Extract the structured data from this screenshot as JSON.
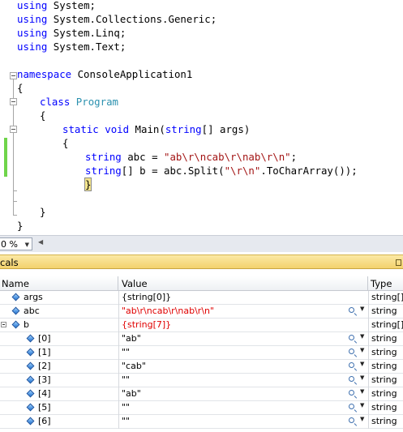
{
  "editor": {
    "lines": [
      {
        "indent": 0,
        "parts": [
          {
            "t": "using",
            "c": "kw"
          },
          {
            "t": " System;",
            "c": ""
          }
        ]
      },
      {
        "indent": 0,
        "parts": [
          {
            "t": "using",
            "c": "kw"
          },
          {
            "t": " System.Collections.Generic;",
            "c": ""
          }
        ]
      },
      {
        "indent": 0,
        "parts": [
          {
            "t": "using",
            "c": "kw"
          },
          {
            "t": " System.Linq;",
            "c": ""
          }
        ]
      },
      {
        "indent": 0,
        "parts": [
          {
            "t": "using",
            "c": "kw"
          },
          {
            "t": " System.Text;",
            "c": ""
          }
        ]
      },
      {
        "indent": 0,
        "parts": []
      },
      {
        "indent": 0,
        "parts": [
          {
            "t": "namespace",
            "c": "kw"
          },
          {
            "t": " ConsoleApplication1",
            "c": ""
          }
        ]
      },
      {
        "indent": 0,
        "parts": [
          {
            "t": "{",
            "c": ""
          }
        ]
      },
      {
        "indent": 1,
        "parts": [
          {
            "t": "class",
            "c": "kw"
          },
          {
            "t": " ",
            "c": ""
          },
          {
            "t": "Program",
            "c": "ty"
          }
        ]
      },
      {
        "indent": 1,
        "parts": [
          {
            "t": "{",
            "c": ""
          }
        ]
      },
      {
        "indent": 2,
        "parts": [
          {
            "t": "static",
            "c": "kw"
          },
          {
            "t": " ",
            "c": ""
          },
          {
            "t": "void",
            "c": "kw"
          },
          {
            "t": " Main(",
            "c": ""
          },
          {
            "t": "string",
            "c": "kw"
          },
          {
            "t": "[] args)",
            "c": ""
          }
        ]
      },
      {
        "indent": 2,
        "parts": [
          {
            "t": "{",
            "c": ""
          }
        ]
      },
      {
        "indent": 3,
        "parts": [
          {
            "t": "string",
            "c": "kw"
          },
          {
            "t": " abc = ",
            "c": ""
          },
          {
            "t": "\"ab\\r\\ncab\\r\\nab\\r\\n\"",
            "c": "str"
          },
          {
            "t": ";",
            "c": ""
          }
        ]
      },
      {
        "indent": 3,
        "parts": [
          {
            "t": "string",
            "c": "kw"
          },
          {
            "t": "[] b = abc.Split(",
            "c": ""
          },
          {
            "t": "\"\\r\\n\"",
            "c": "str"
          },
          {
            "t": ".ToCharArray());",
            "c": ""
          }
        ]
      },
      {
        "indent": 3,
        "parts": [
          {
            "t": "}",
            "c": "caret"
          }
        ]
      },
      {
        "indent": 2,
        "parts": []
      },
      {
        "indent": 1,
        "parts": [
          {
            "t": "}",
            "c": ""
          }
        ]
      },
      {
        "indent": 0,
        "parts": [
          {
            "t": "}",
            "c": ""
          }
        ]
      }
    ]
  },
  "zoom": {
    "value": "0 %"
  },
  "locals": {
    "title": "cals",
    "columns": {
      "name": "Name",
      "value": "Value",
      "type": "Type"
    },
    "rows": [
      {
        "name": "args",
        "value": "{string[0]}",
        "type": "string[]",
        "level": 1,
        "expander": false,
        "red": false,
        "visualizer": false
      },
      {
        "name": "abc",
        "value": "\"ab\\r\\ncab\\r\\nab\\r\\n\"",
        "type": "string",
        "level": 1,
        "expander": false,
        "red": true,
        "visualizer": true
      },
      {
        "name": "b",
        "value": "{string[7]}",
        "type": "string[]",
        "level": 1,
        "expander": true,
        "red": true,
        "visualizer": false
      },
      {
        "name": "[0]",
        "value": "\"ab\"",
        "type": "string",
        "level": 2,
        "expander": false,
        "red": false,
        "visualizer": true
      },
      {
        "name": "[1]",
        "value": "\"\"",
        "type": "string",
        "level": 2,
        "expander": false,
        "red": false,
        "visualizer": true
      },
      {
        "name": "[2]",
        "value": "\"cab\"",
        "type": "string",
        "level": 2,
        "expander": false,
        "red": false,
        "visualizer": true
      },
      {
        "name": "[3]",
        "value": "\"\"",
        "type": "string",
        "level": 2,
        "expander": false,
        "red": false,
        "visualizer": true
      },
      {
        "name": "[4]",
        "value": "\"ab\"",
        "type": "string",
        "level": 2,
        "expander": false,
        "red": false,
        "visualizer": true
      },
      {
        "name": "[5]",
        "value": "\"\"",
        "type": "string",
        "level": 2,
        "expander": false,
        "red": false,
        "visualizer": true
      },
      {
        "name": "[6]",
        "value": "\"\"",
        "type": "string",
        "level": 2,
        "expander": false,
        "red": false,
        "visualizer": true
      }
    ]
  }
}
